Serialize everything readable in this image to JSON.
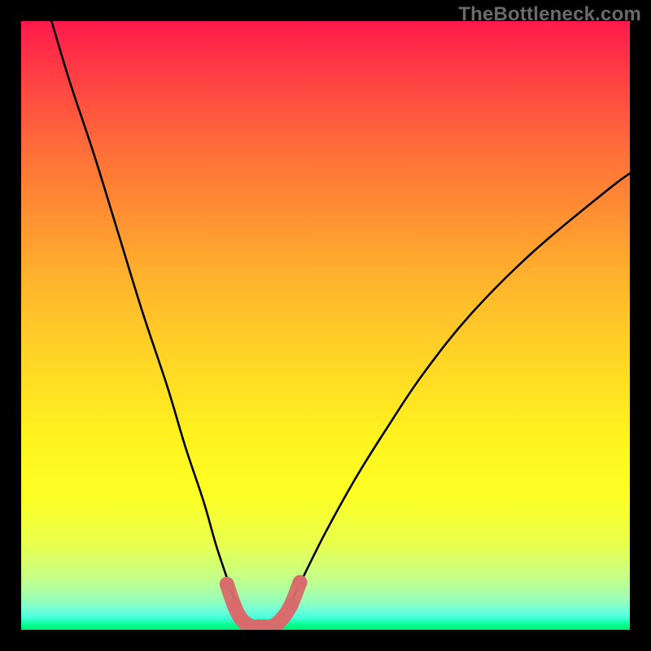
{
  "watermark": "TheBottleneck.com",
  "chart_data": {
    "type": "line",
    "title": "",
    "xlabel": "",
    "ylabel": "",
    "xlim": [
      0,
      100
    ],
    "ylim": [
      0,
      100
    ],
    "series": [
      {
        "name": "bottleneck-curve",
        "x": [
          5,
          8,
          12,
          16,
          20,
          24,
          27,
          30,
          32,
          34,
          35.5,
          37,
          38.5,
          40,
          42,
          44,
          46,
          50,
          55,
          60,
          66,
          74,
          84,
          96,
          100
        ],
        "y": [
          100,
          90,
          78,
          65,
          52,
          40,
          30,
          21,
          14,
          8,
          4,
          1.5,
          0.5,
          0.5,
          1.5,
          4,
          8,
          16,
          25,
          33,
          42,
          52,
          62,
          72,
          75
        ]
      }
    ],
    "valley_markers": {
      "name": "valley-points",
      "x": [
        33.8,
        35.0,
        36.0,
        37.0,
        38.0,
        39.0,
        40.0,
        41.0,
        42.0,
        43.0,
        44.3,
        45.8
      ],
      "y": [
        7.5,
        4.0,
        2.0,
        1.0,
        0.5,
        0.5,
        0.5,
        0.5,
        1.0,
        2.0,
        4.0,
        7.8
      ]
    },
    "colors": {
      "curve": "#000000",
      "markers": "#d86b6b",
      "gradient_top": "#ff1a4d",
      "gradient_bottom": "#00eb74"
    }
  }
}
